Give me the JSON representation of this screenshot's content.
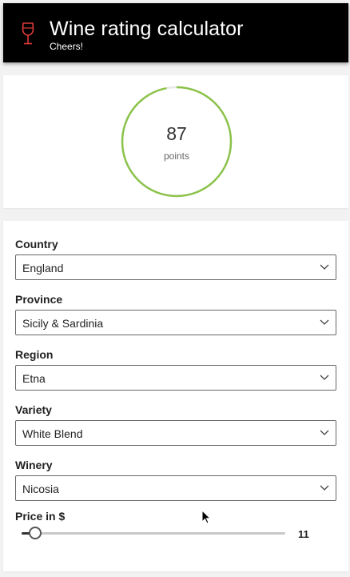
{
  "header": {
    "title": "Wine rating calculator",
    "subtitle": "Cheers!",
    "icon": "wine-glass-icon",
    "icon_color": "#e03a3a",
    "background": "#000000"
  },
  "score": {
    "value": "87",
    "unit": "points",
    "progress_fraction": 0.97,
    "ring_color": "#8bc34a"
  },
  "form": {
    "fields": [
      {
        "label": "Country",
        "value": "England"
      },
      {
        "label": "Province",
        "value": "Sicily & Sardinia"
      },
      {
        "label": "Region",
        "value": "Etna"
      },
      {
        "label": "Variety",
        "value": "White Blend"
      },
      {
        "label": "Winery",
        "value": "Nicosia"
      }
    ],
    "price": {
      "label": "Price in $",
      "value": "11",
      "fraction": 0.05
    }
  }
}
